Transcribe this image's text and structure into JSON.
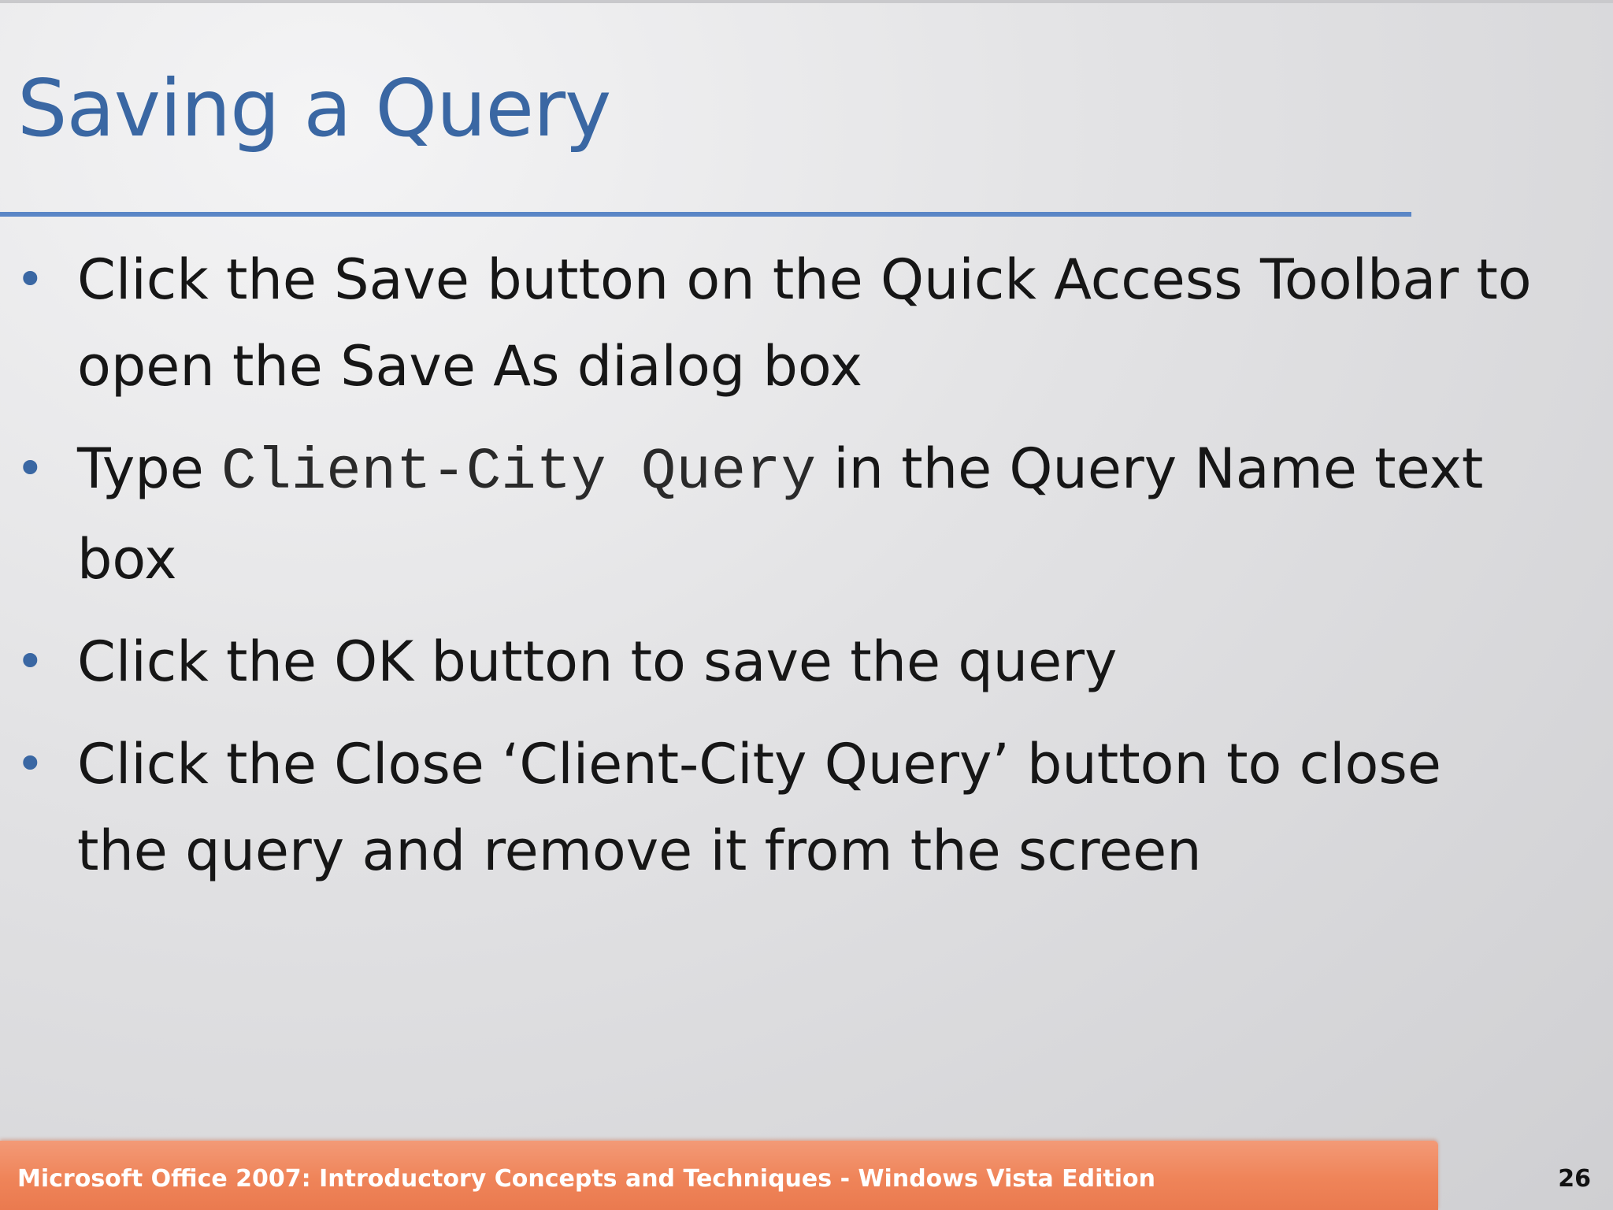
{
  "slide": {
    "title": "Saving a Query",
    "bullets": [
      {
        "text": "Click the Save button on the Quick Access Toolbar to open the Save As dialog box"
      },
      {
        "prefix": "Type ",
        "code": "Client-City Query",
        "suffix": " in the Query Name text box"
      },
      {
        "text": "Click the OK button to save the query"
      },
      {
        "text": "Click the Close ‘Client-City Query’ button to close the query and remove it from the screen"
      }
    ],
    "bullet_glyph": "•"
  },
  "footer": {
    "text": "Microsoft Office 2007: Introductory Concepts and Techniques - Windows Vista Edition",
    "page_number": "26"
  },
  "colors": {
    "title": "#3a67a3",
    "rule": "#5a86c6",
    "footer_bar": "#ef8459"
  }
}
